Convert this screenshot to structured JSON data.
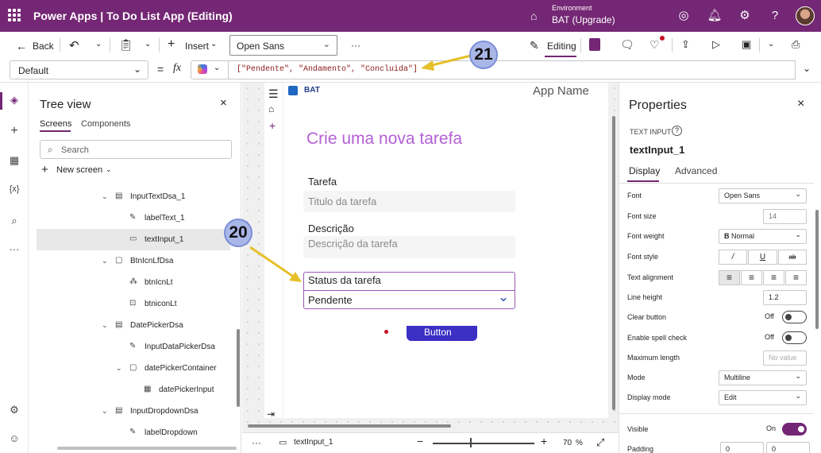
{
  "topbar": {
    "app_title": "Power Apps  |  To Do List App (Editing)",
    "env_label": "Environment",
    "env_value": "BAT (Upgrade)"
  },
  "cmdbar": {
    "back": "Back",
    "insert": "Insert",
    "font": "Open Sans",
    "more": "···",
    "editing": "Editing"
  },
  "formula_bar": {
    "property": "Default",
    "equals": "=",
    "fx": "fx",
    "formula": "[\"Pendente\", \"Andamento\", \"Concluida\"]"
  },
  "tree": {
    "title": "Tree view",
    "tabs": [
      "Screens",
      "Components"
    ],
    "search_placeholder": "Search",
    "new_screen": "New screen",
    "items": [
      {
        "label": "InputTextDsa_1",
        "icon": "group-icon",
        "indent": 1,
        "expanded": true
      },
      {
        "label": "labelText_1",
        "icon": "label-icon",
        "indent": 2
      },
      {
        "label": "textInput_1",
        "icon": "text-input-icon",
        "indent": 2,
        "selected": true
      },
      {
        "label": "BtnIcnLfDsa",
        "icon": "container-icon",
        "indent": 1,
        "expanded": true
      },
      {
        "label": "btnIcnLt",
        "icon": "icon-icon",
        "indent": 2
      },
      {
        "label": "btniconLt",
        "icon": "button-icon",
        "indent": 2
      },
      {
        "label": "DatePickerDsa",
        "icon": "group-icon",
        "indent": 1,
        "expanded": true
      },
      {
        "label": "InputDataPickerDsa",
        "icon": "label-icon",
        "indent": 2
      },
      {
        "label": "datePickerContainer",
        "icon": "container-icon",
        "indent": 2,
        "expanded": true
      },
      {
        "label": "datePickerInput",
        "icon": "calendar-icon",
        "indent": 3
      },
      {
        "label": "InputDropdownDsa",
        "icon": "group-icon",
        "indent": 1,
        "expanded": true
      },
      {
        "label": "labelDropdown",
        "icon": "label-icon",
        "indent": 2
      }
    ]
  },
  "canvas": {
    "app_name": "App Name",
    "logo_text": "BAT",
    "heading": "Crie uma nova tarefa",
    "field1_label": "Tarefa",
    "field1_placeholder": "Titulo da tarefa",
    "field2_label": "Descrição",
    "field2_placeholder": "Descrição da tarefa",
    "field3_label": "Status da tarefa",
    "field3_value": "Pendente",
    "button_label": "Button",
    "callout_20": "20",
    "callout_21": "21"
  },
  "footer": {
    "more": "···",
    "selected": "textInput_1",
    "zoom": "70",
    "zoom_unit": "%"
  },
  "properties": {
    "title": "Properties",
    "type": "TEXT INPUT",
    "name": "textInput_1",
    "tabs": [
      "Display",
      "Advanced"
    ],
    "rows": {
      "font_label": "Font",
      "font_value": "Open Sans",
      "font_size_label": "Font size",
      "font_size_value": "14",
      "font_weight_label": "Font weight",
      "font_weight_value": "Normal",
      "font_style_label": "Font style",
      "text_align_label": "Text alignment",
      "line_height_label": "Line height",
      "line_height_value": "1.2",
      "clear_button_label": "Clear button",
      "clear_button_value": "Off",
      "spell_label": "Enable spell check",
      "spell_value": "Off",
      "maxlen_label": "Maximum length",
      "maxlen_placeholder": "No value",
      "mode_label": "Mode",
      "mode_value": "Multiline",
      "display_mode_label": "Display mode",
      "display_mode_value": "Edit",
      "visible_label": "Visible",
      "visible_value": "On",
      "padding_label": "Padding",
      "padding_top": "0",
      "padding_bottom": "0"
    }
  },
  "colors": {
    "brand": "#742774",
    "accent_text": "#b560d4",
    "callout": "#a9b7e8",
    "arrow": "#e6c02a"
  }
}
